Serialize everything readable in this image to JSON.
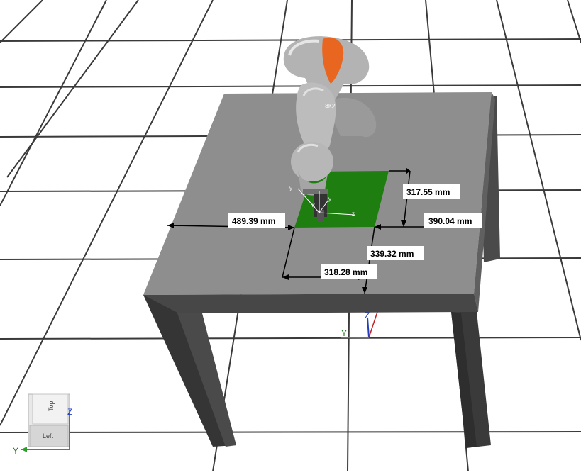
{
  "viewport": {
    "name": "3D robot simulation viewport"
  },
  "dimensions": [
    {
      "id": "dim-317",
      "label": "317.55 mm"
    },
    {
      "id": "dim-390",
      "label": "390.04 mm"
    },
    {
      "id": "dim-489",
      "label": "489.39 mm"
    },
    {
      "id": "dim-339",
      "label": "339.32 mm"
    },
    {
      "id": "dim-318",
      "label": "318.28 mm"
    }
  ],
  "world_axes": {
    "y_label": "Y",
    "z_label": "Z"
  },
  "tool_frame": {
    "x_label": "x",
    "y_label": "y",
    "z_label": "z"
  },
  "view_cube": {
    "top_label": "Top",
    "left_label": "Left",
    "y_axis": "Y",
    "z_axis": "Z"
  },
  "colors": {
    "background": "#ffffff",
    "grid": "#3a3a3a",
    "table_top": "#8e8e8e",
    "table_side": "#3d3d3d",
    "target_area": "#1e7e10",
    "robot_accent": "#e8661f"
  }
}
